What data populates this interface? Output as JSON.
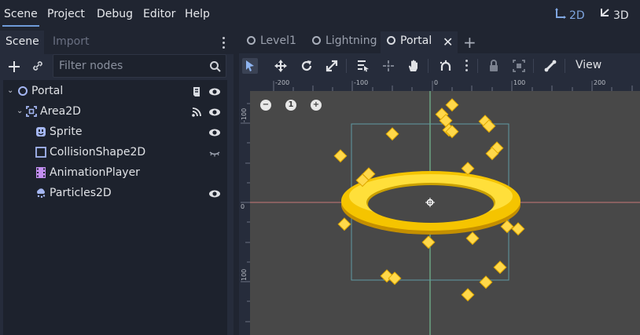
{
  "menu": {
    "items": [
      "Scene",
      "Project",
      "Debug",
      "Editor",
      "Help"
    ]
  },
  "modes": {
    "two_d": "2D",
    "three_d": "3D"
  },
  "dock": {
    "tabs": [
      "Scene",
      "Import"
    ],
    "filter_placeholder": "Filter nodes",
    "nodes": [
      {
        "label": "Portal",
        "icon": "node2d-icon"
      },
      {
        "label": "Area2D",
        "icon": "area2d-icon"
      },
      {
        "label": "Sprite",
        "icon": "sprite-icon"
      },
      {
        "label": "CollisionShape2D",
        "icon": "collisionshape-icon"
      },
      {
        "label": "AnimationPlayer",
        "icon": "animationplayer-icon"
      },
      {
        "label": "Particles2D",
        "icon": "particles-icon"
      }
    ]
  },
  "editor": {
    "tabs": [
      "Level1",
      "Lightning",
      "Portal"
    ],
    "view_label": "View",
    "zoom_reset": "1"
  },
  "ruler": {
    "h_labels": [
      "-200",
      "-100",
      "0",
      "100",
      "200"
    ],
    "v_labels": [
      "-100",
      "0",
      "100"
    ]
  },
  "colors": {
    "accent": "#6f9bd9",
    "viewport": "#484848",
    "panel": "#262c3b",
    "ring": "#f5c400",
    "particle": "#ffd84a"
  }
}
